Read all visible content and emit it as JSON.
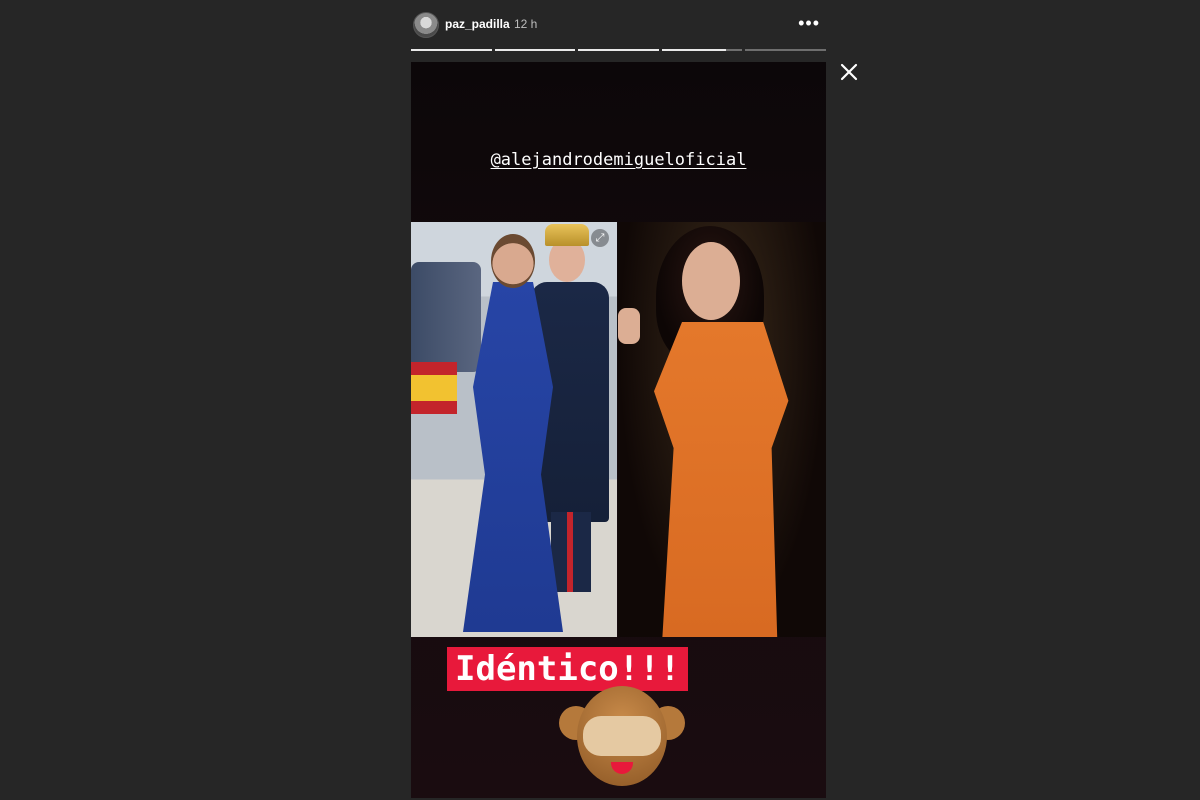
{
  "header": {
    "username": "paz_padilla",
    "timestamp": "12 h",
    "more_glyph": "•••",
    "close_icon": "close-icon"
  },
  "progress": {
    "segments": [
      1,
      1,
      1,
      0.8,
      0
    ]
  },
  "story": {
    "mention": "@alejandrodemigueloficial",
    "expand_glyph": "⤢",
    "caption": "Idéntico!!!",
    "sticker": "see-no-evil-monkey"
  },
  "colors": {
    "background": "#262626",
    "caption_bg": "#e8193b",
    "dress_left": "#2745a6",
    "dress_right": "#e4782b"
  }
}
